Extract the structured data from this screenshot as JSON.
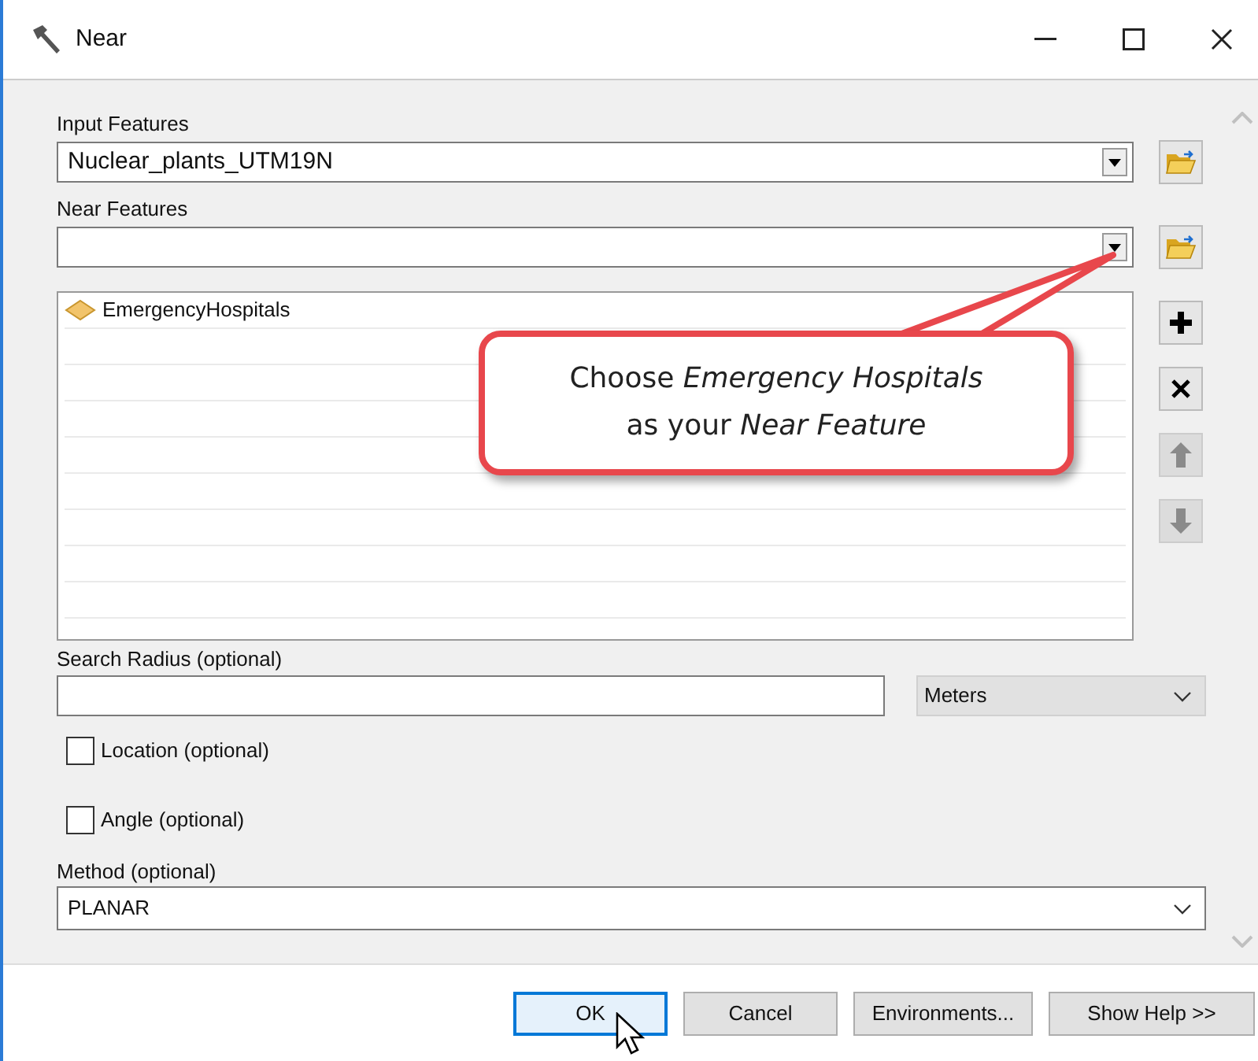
{
  "window": {
    "title": "Near"
  },
  "input_features": {
    "label": "Input Features",
    "value": "Nuclear_plants_UTM19N"
  },
  "near_features": {
    "label": "Near Features",
    "items": [
      {
        "label": "EmergencyHospitals"
      }
    ]
  },
  "search_radius": {
    "label": "Search Radius (optional)",
    "unit": "Meters"
  },
  "checkboxes": [
    {
      "label": "Location (optional)",
      "checked": false
    },
    {
      "label": "Angle (optional)",
      "checked": false
    }
  ],
  "method": {
    "label": "Method (optional)",
    "value": "PLANAR"
  },
  "buttons": [
    {
      "label": "OK",
      "default": true
    },
    {
      "label": "Cancel",
      "default": false
    },
    {
      "label": "Environments...",
      "default": false
    },
    {
      "label": "Show Help >>",
      "default": false
    }
  ],
  "callout": {
    "lines": [
      "Choose *Emergency Hospitals*",
      "as your *Near Feature*"
    ]
  }
}
